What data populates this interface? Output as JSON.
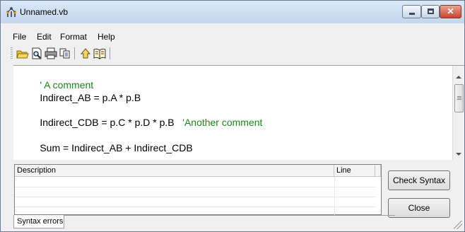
{
  "window": {
    "title": "Unnamed.vb",
    "app_icon": "network-graph-icon",
    "controls": {
      "minimize_icon": "minimize-icon",
      "maximize_icon": "maximize-icon",
      "close_icon": "close-icon",
      "close_glyph": "✕"
    }
  },
  "menu": {
    "items": [
      "File",
      "Edit",
      "Format",
      "Help"
    ]
  },
  "toolbar": {
    "buttons": [
      "open-folder-icon",
      "print-preview-icon",
      "print-icon",
      "copy-icon",
      "pointer-help-icon",
      "book-help-icon"
    ]
  },
  "editor": {
    "lines": [
      {
        "code": "",
        "comment": "' A comment"
      },
      {
        "code": "Indirect_AB = p.A * p.B",
        "comment": ""
      },
      {
        "code": "Indirect_CDB = p.C * p.D * p.B   ",
        "comment": "'Another comment"
      },
      {
        "code": "Sum = Indirect_AB + Indirect_CDB",
        "comment": ""
      }
    ],
    "comment_color": "#1a8a1a"
  },
  "errors": {
    "columns": [
      "Description",
      "Line"
    ],
    "rows": []
  },
  "actions": {
    "check_syntax": "Check Syntax",
    "close": "Close"
  },
  "tabs": {
    "active": "Syntax errors"
  }
}
